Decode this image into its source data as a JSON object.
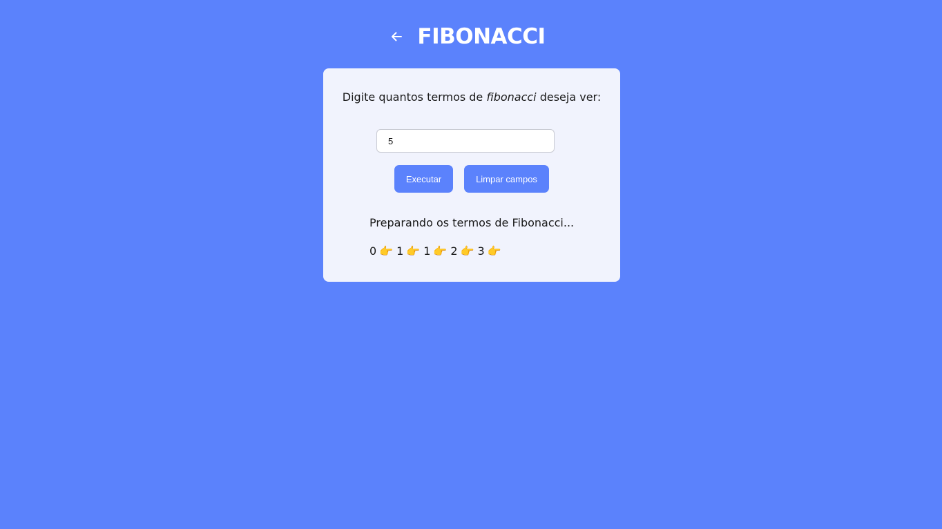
{
  "header": {
    "back_icon": "arrow-left-icon",
    "title": "FIBONACCI"
  },
  "form": {
    "prompt_before": "Digite quantos termos de ",
    "prompt_emphasis": "fibonacci",
    "prompt_after": " deseja ver:",
    "input_value": "5",
    "execute_label": "Executar",
    "clear_label": "Limpar campos"
  },
  "result": {
    "status": "Preparando os termos de Fibonacci...",
    "terms": [
      "0",
      "1",
      "1",
      "2",
      "3"
    ],
    "separator_icon": "pointing-right-hand-icon",
    "separator_glyph": "👉"
  },
  "colors": {
    "background": "#5b82fc",
    "card": "#f1f3fd",
    "button": "#5b82fc"
  }
}
